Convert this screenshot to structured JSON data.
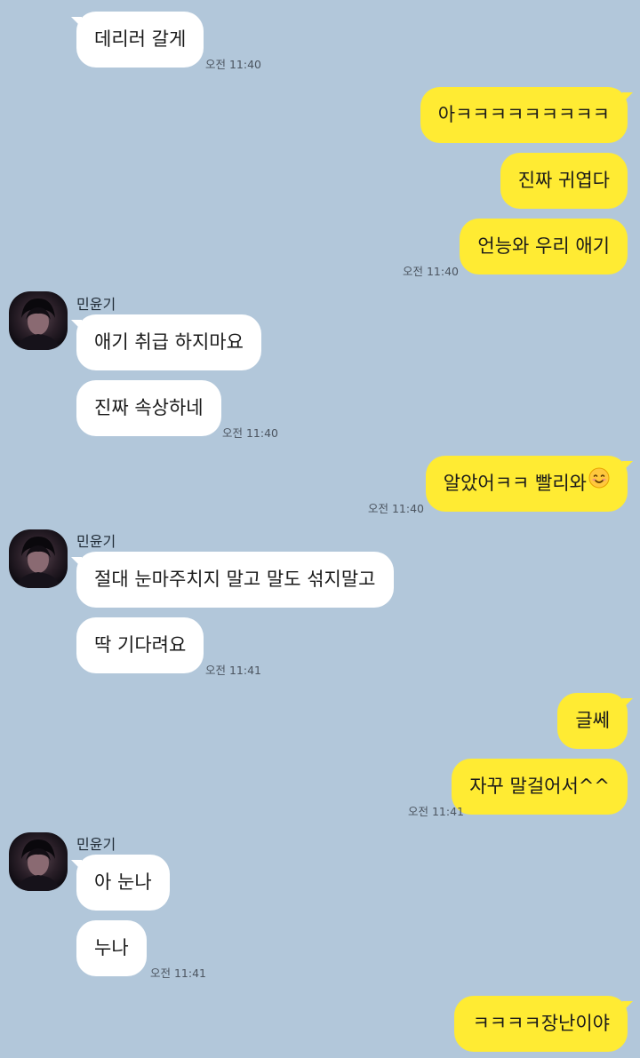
{
  "contact": {
    "name": "민윤기"
  },
  "messages": [
    {
      "text": "데리러 갈게",
      "time": "오전 11:40"
    },
    {
      "text": "아ㅋㅋㅋㅋㅋㅋㅋㅋㅋ"
    },
    {
      "text": "진짜 귀엽다"
    },
    {
      "text": "언능와 우리 애기",
      "time": "오전 11:40"
    },
    {
      "text": "애기 취급 하지마요"
    },
    {
      "text": "진짜 속상하네",
      "time": "오전 11:40"
    },
    {
      "text": "알았어ㅋㅋ 빨리와",
      "emoji": "smiling-face-icon",
      "time": "오전 11:40"
    },
    {
      "text": "절대 눈마주치지 말고 말도 섞지말고"
    },
    {
      "text": "딱 기다려요",
      "time": "오전 11:41"
    },
    {
      "text": "글쎄"
    },
    {
      "text": "자꾸 말걸어서^^",
      "time": "오전 11:41"
    },
    {
      "text": "아 눈나"
    },
    {
      "text": "누나",
      "time": "오전 11:41"
    },
    {
      "text": "ㅋㅋㅋㅋ장난이야"
    }
  ],
  "colors": {
    "background": "#b2c7da",
    "outgoing": "#ffeb33",
    "incoming": "#ffffff"
  }
}
